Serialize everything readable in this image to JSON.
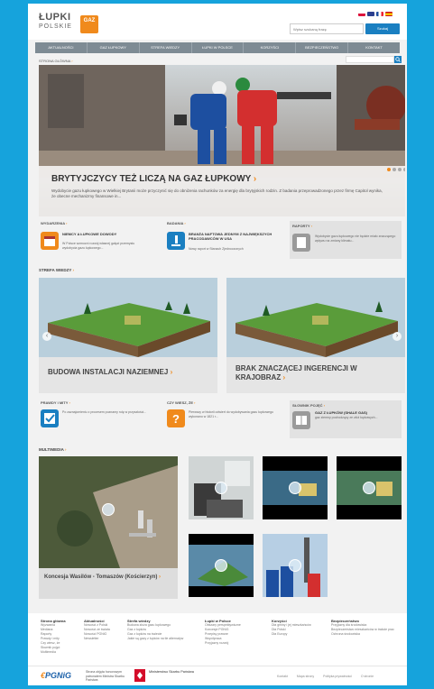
{
  "header": {
    "logo_line1": "ŁUPKI",
    "logo_line2": "POLSKIE",
    "logo_badge": "GAZ",
    "search_placeholder": "Wpisz szukaną frazę",
    "search_button": "Szukaj",
    "flags": [
      {
        "name": "flag-pl",
        "color": "#dc143c"
      },
      {
        "name": "flag-en",
        "color": "#2b3f8f"
      },
      {
        "name": "flag-fr",
        "color": "#1f4fa0"
      },
      {
        "name": "flag-es",
        "color": "#e0a800"
      }
    ]
  },
  "nav": {
    "items": [
      "Aktualności",
      "Gaz łupkowy",
      "Strefa wiedzy",
      "Łupki w Polsce",
      "Korzyści",
      "Bezpieczeństwo",
      "Kontakt"
    ]
  },
  "breadcrumb": "STRONA GŁÓWNA",
  "hero": {
    "title": "BRYTYJCZYCY TEŻ LICZĄ NA GAZ ŁUPKOWY",
    "desc": "Wydobycie gazu łupkowego w Wielkiej Brytanii może przyczynić się do obniżenia rachunków za energię dla brytyjskich rodzin. Z badania przeprowadzonego przez firmę Capitol wynika, że obecne mechanizmy finansowe in...",
    "dots": 4
  },
  "info_row_1": [
    {
      "head": "WYDARZENIA",
      "icon": "calendar-icon",
      "color": "#f08a1c",
      "title": "NIEMCY A ŁUPKOWE DOWODY",
      "text": "W Polsce wzmocni rozwój własnej gałęzi przemysłu wydobycia gazu łupkowego..."
    },
    {
      "head": "BADANIA",
      "icon": "microscope-icon",
      "color": "#1a7fc1",
      "title": "BRANŻA NAFTOWA JEDNYM Z NAJWIĘKSZYCH PRACODAWCÓW W USA",
      "text": "Nowy raport w Stanach Zjednoczonych"
    },
    {
      "head": "RAPORTY",
      "icon": "document-icon",
      "color": "#9a9a9a",
      "title": "",
      "text": "Wydobycie gazu łupkowego nie będzie miało znaczącego wpływu na zmiany klimatu..."
    }
  ],
  "knowledge_zone": {
    "title": "STREFA WIEDZY",
    "items": [
      {
        "caption": "BUDOWA INSTALACJI NAZIEMNEJ"
      },
      {
        "caption": "BRAK ZNACZĄCEJ INGERENCJI W KRAJOBRAZ"
      }
    ]
  },
  "info_row_2": [
    {
      "head": "PRAWDY I MITY",
      "icon": "checkmark-icon",
      "color": "#1a7fc1",
      "text": "Po zaznajomieniu z procesem poznamy rolę w przyszłości..."
    },
    {
      "head": "CZY WIESZ, ŻE",
      "icon": "question-icon",
      "color": "#f08a1c",
      "text": "Pierwszy w historii odwiert do wydobywania gazu łupkowego wykonano w 1821 r..."
    },
    {
      "head": "SŁOWNIK POJĘĆ",
      "icon": "book-icon",
      "color": "#9a9a9a",
      "title": "GAZ Z ŁUPKÓW (SHALE GAS)",
      "text": "gaz ziemny pochodzący ze złóż łupkowych..."
    }
  ],
  "multimedia": {
    "title": "MULTIMEDIA",
    "big_caption": "Koncesja Wasilów - Tomaszów (Kościerzyn)"
  },
  "footer": {
    "columns": [
      {
        "title": "Strona główna",
        "items": [
          "Wyzwania",
          "Mediana",
          "Raporty",
          "Prawdy i mity",
          "Czy wiesz, że",
          "Słownik pojęć",
          "Multimedia"
        ]
      },
      {
        "title": "Aktualności",
        "items": [
          "Nowości z Polski",
          "Nowości ze świata",
          "Nowości PGNiG",
          "Newsletter"
        ]
      },
      {
        "title": "Strefa wiedzy",
        "items": [
          "Budowa złoża gazu łupkowego",
          "Gaz z łupków",
          "Gaz z łupków na świecie",
          "Jakie są gazy z łupków na tle alternatyw"
        ]
      },
      {
        "title": "Łupki w Polsce",
        "items": [
          "Obszary perspektywiczne",
          "Koncesje PGNiG",
          "Przepisy prawne",
          "Współpraca",
          "Przyjazny rozwój"
        ]
      },
      {
        "title": "Korzyści",
        "items": [
          "Dla gminy i jej mieszkańców",
          "Dla Polski",
          "Dla Europy"
        ]
      },
      {
        "title": "Bezpieczeństwo",
        "items": [
          "Przyjazny dla środowiska",
          "Bezpieczeństwo mieszkańców w trakcie prac",
          "Ochrona środowiska"
        ]
      }
    ],
    "pgnig": "PGNiG",
    "partner_text": "Strona objęta honorowym patronatem Ministra Skarbu Państwa",
    "ministry": "Ministerstwo Skarbu Państwa",
    "bottom_links": [
      "Kontakt",
      "Mapa strony",
      "Polityka prywatności",
      "O stronie"
    ]
  }
}
